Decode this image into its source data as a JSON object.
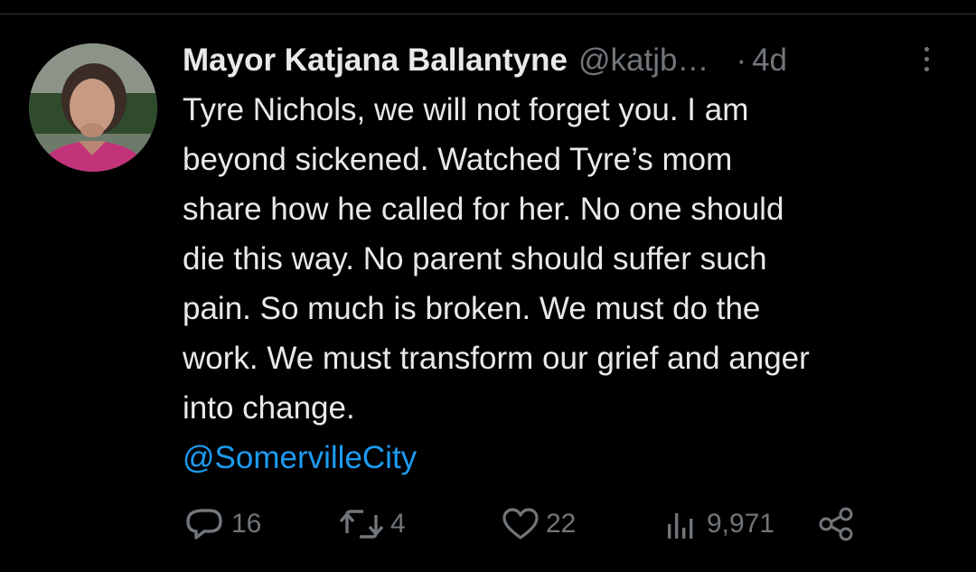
{
  "tweet": {
    "author_name": "Mayor Katjana Ballantyne",
    "author_handle": "@katjb…",
    "dot": "·",
    "time": "4d",
    "text": "Tyre Nichols, we will not forget you. I am\nbeyond sickened. Watched Tyre’s mom\nshare how he called for her. No one should\ndie this way. No parent should suffer such\npain. So much is broken. We must do the\nwork. We must transform our grief and anger\ninto change.",
    "mention": "@SomervilleCity"
  },
  "actions": {
    "replies": "16",
    "retweets": "4",
    "likes": "22",
    "views": "9,971"
  },
  "icons": {
    "reply": "reply-icon",
    "retweet": "retweet-icon",
    "like": "heart-icon",
    "views": "views-icon",
    "share": "share-icon",
    "more": "more-options-icon"
  },
  "colors": {
    "background": "#000000",
    "text": "#e7e9ea",
    "secondary": "#71767b",
    "link": "#1d9bf0",
    "avatar_shirt": "#c2337a"
  }
}
